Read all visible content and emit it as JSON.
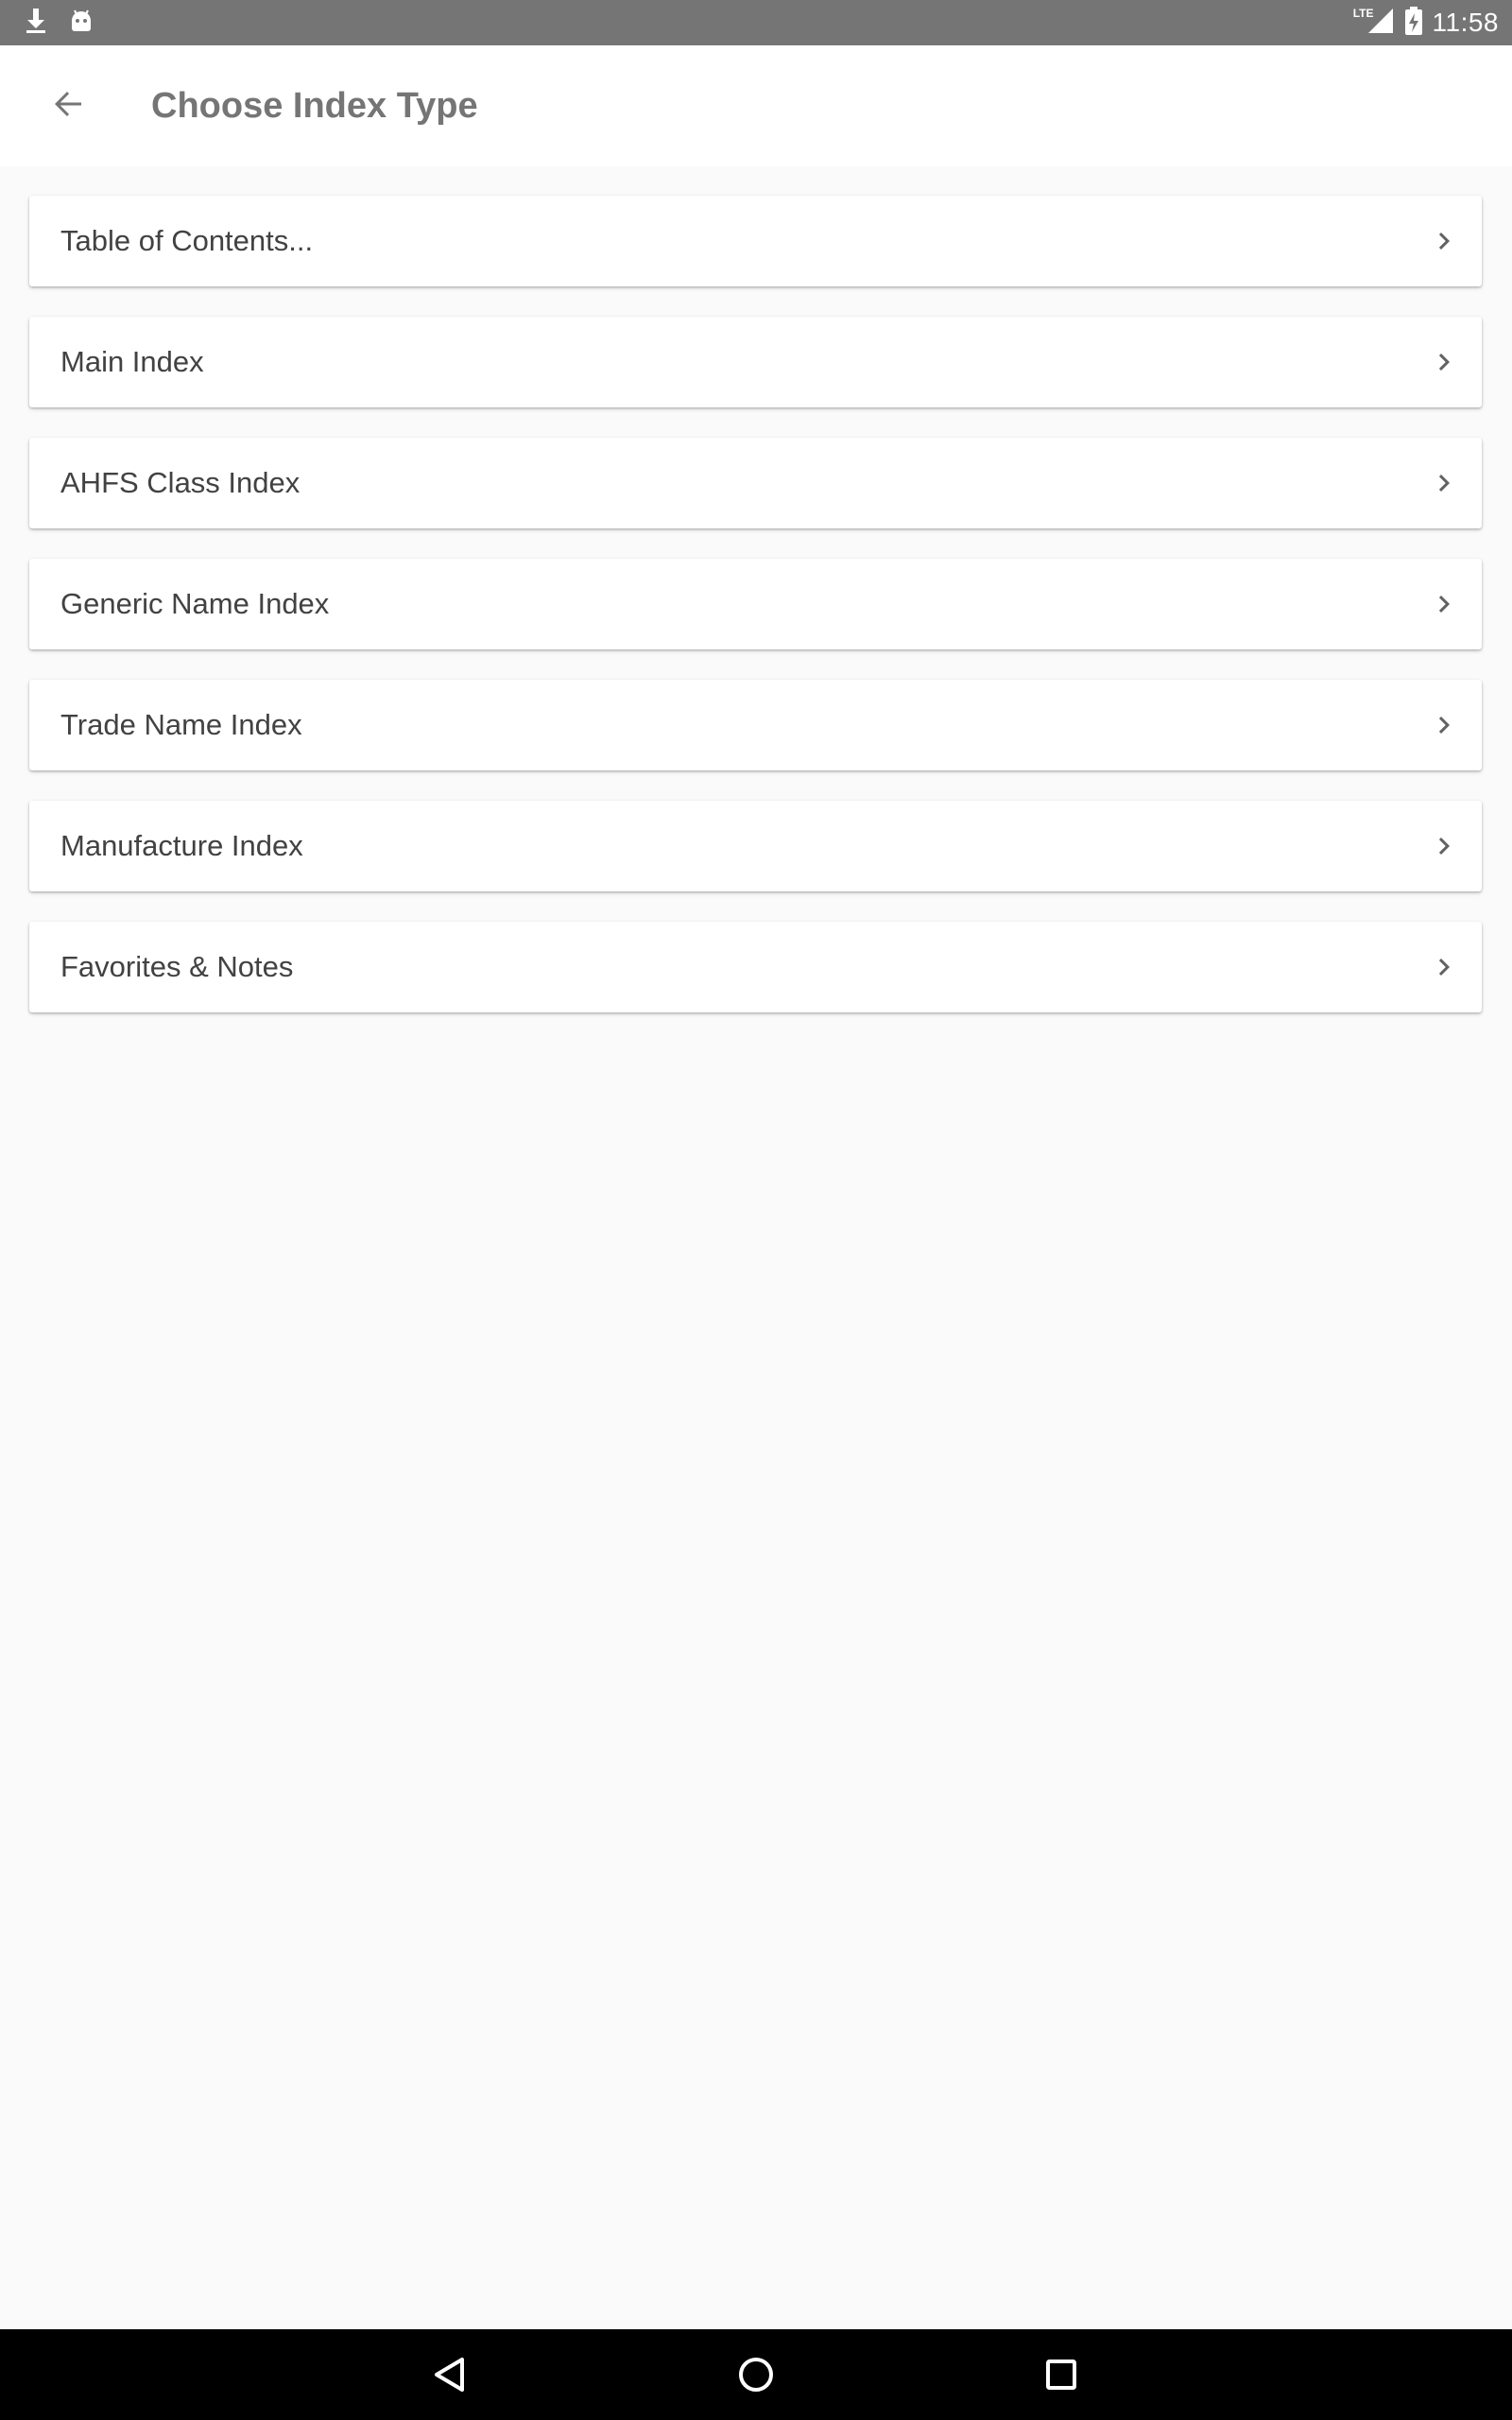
{
  "status_bar": {
    "time": "11:58",
    "network": "LTE",
    "icons": [
      "download-icon",
      "android-icon",
      "signal-icon",
      "battery-charging-icon"
    ]
  },
  "app_bar": {
    "title": "Choose Index Type",
    "back_icon": "arrow-back-icon"
  },
  "index_types": [
    {
      "label": "Table of Contents..."
    },
    {
      "label": "Main Index"
    },
    {
      "label": "AHFS Class Index"
    },
    {
      "label": "Generic Name Index"
    },
    {
      "label": "Trade Name Index"
    },
    {
      "label": "Manufacture Index"
    },
    {
      "label": "Favorites & Notes"
    }
  ],
  "nav_bar": {
    "icons": [
      "nav-back-icon",
      "nav-home-icon",
      "nav-recents-icon"
    ]
  },
  "colors": {
    "status_bar": "#757575",
    "app_bar": "#ffffff",
    "background": "#fafafa",
    "title_text": "#757575",
    "item_text": "#424242",
    "nav_bar": "#000000"
  }
}
